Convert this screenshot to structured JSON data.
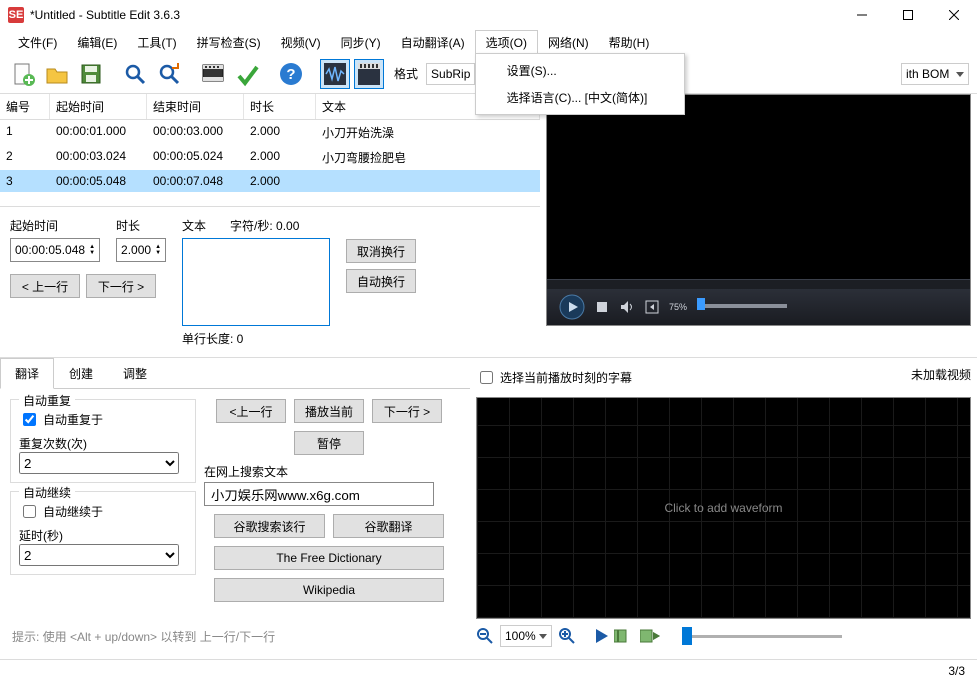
{
  "title": "*Untitled - Subtitle Edit 3.6.3",
  "menu": {
    "file": "文件(F)",
    "edit": "编辑(E)",
    "tools": "工具(T)",
    "spell": "拼写检查(S)",
    "video": "视频(V)",
    "sync": "同步(Y)",
    "autotrans": "自动翻译(A)",
    "options": "选项(O)",
    "net": "网络(N)",
    "help": "帮助(H)"
  },
  "options_dropdown": {
    "settings": "设置(S)...",
    "language": "选择语言(C)... [中文(简体)]"
  },
  "format": {
    "label": "格式",
    "value": "SubRip",
    "encoding_suffix": "ith BOM"
  },
  "table": {
    "headers": {
      "num": "编号",
      "start": "起始时间",
      "end": "结束时间",
      "dur": "时长",
      "text": "文本"
    },
    "rows": [
      {
        "num": "1",
        "start": "00:00:01.000",
        "end": "00:00:03.000",
        "dur": "2.000",
        "text": "小刀开始洗澡"
      },
      {
        "num": "2",
        "start": "00:00:03.024",
        "end": "00:00:05.024",
        "dur": "2.000",
        "text": "小刀弯腰捡肥皂"
      },
      {
        "num": "3",
        "start": "00:00:05.048",
        "end": "00:00:07.048",
        "dur": "2.000",
        "text": ""
      }
    ]
  },
  "editor": {
    "start_label": "起始时间",
    "start_value": "00:00:05.048",
    "dur_label": "时长",
    "dur_value": "2.000",
    "text_label": "文本",
    "cps_label": "字符/秒: 0.00",
    "prev": "< 上一行",
    "next": "下一行 >",
    "line_len": "单行长度: 0",
    "unbreak": "取消换行",
    "rebreak": "自动换行"
  },
  "tabs": {
    "translate": "翻译",
    "create": "创建",
    "adjust": "调整"
  },
  "tpanel": {
    "autorepeat": "自动重复",
    "autorepeat_on": "自动重复于",
    "repeat_count": "重复次数(次)",
    "repeat_val": "2",
    "autocontinue": "自动继续",
    "autocontinue_on": "自动继续于",
    "delay": "延时(秒)",
    "delay_val": "2",
    "prev": "<上一行",
    "playcur": "播放当前",
    "next": "下一行 >",
    "pause": "暂停",
    "search_label": "在网上搜索文本",
    "search_val": "小刀娱乐网www.x6g.com",
    "gsearch": "谷歌搜索该行",
    "gtrans": "谷歌翻译",
    "freedict": "The Free Dictionary",
    "wiki": "Wikipedia"
  },
  "wave": {
    "select_at_play": "选择当前播放时刻的字幕",
    "no_video": "未加载视频",
    "click_add": "Click to add waveform",
    "zoom": "100%"
  },
  "hint": "提示: 使用 <Alt + up/down> 以转到 上一行/下一行",
  "status": "3/3",
  "video_pos": "75%"
}
